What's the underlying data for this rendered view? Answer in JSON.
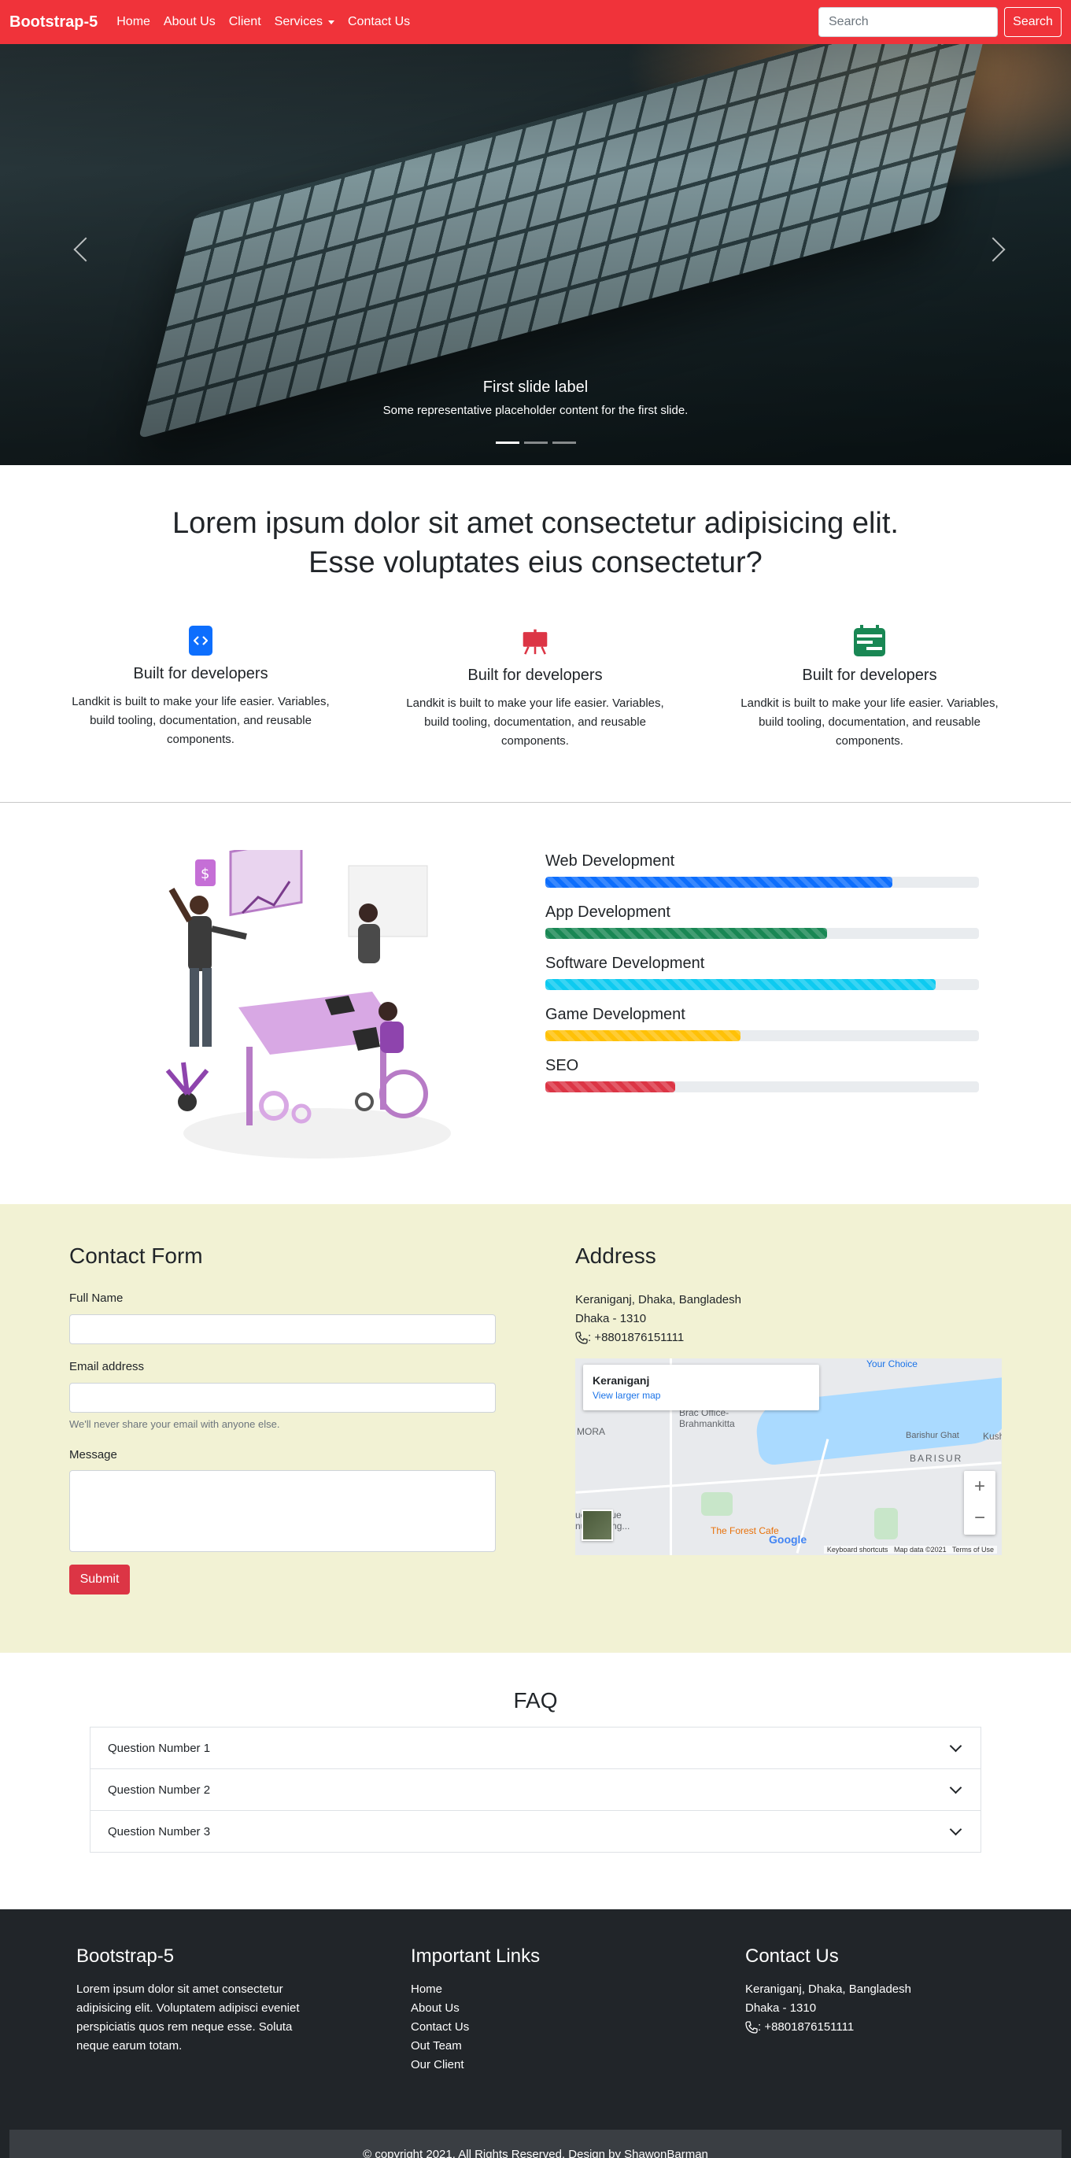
{
  "navbar": {
    "brand": "Bootstrap-5",
    "links": [
      "Home",
      "About Us",
      "Client",
      "Services",
      "Contact Us"
    ],
    "search_placeholder": "Search",
    "search_button": "Search",
    "color": "#f0333a"
  },
  "hero": {
    "caption_title": "First slide label",
    "caption_text": "Some representative placeholder content for the first slide.",
    "slides": 3,
    "active_slide": 1
  },
  "intro": {
    "heading_line1": "Lorem ipsum dolor sit amet consectetur adipisicing elit.",
    "heading_line2": "Esse voluptates eius consectetur?",
    "features": [
      {
        "icon": "code-icon",
        "color": "#0d6efd",
        "title": "Built for developers",
        "text": "Landkit is built to make your life easier. Variables, build tooling, documentation, and reusable components."
      },
      {
        "icon": "easel-icon",
        "color": "#dc3545",
        "title": "Built for developers",
        "text": "Landkit is built to make your life easier. Variables, build tooling, documentation, and reusable components."
      },
      {
        "icon": "calendar-icon",
        "color": "#198754",
        "title": "Built for developers",
        "text": "Landkit is built to make your life easier. Variables, build tooling, documentation, and reusable components."
      }
    ]
  },
  "skills": [
    {
      "label": "Web Development",
      "percent": 80,
      "color": "#0d6efd"
    },
    {
      "label": "App Development",
      "percent": 65,
      "color": "#198754"
    },
    {
      "label": "Software Development",
      "percent": 90,
      "color": "#0dcaf0"
    },
    {
      "label": "Game Development",
      "percent": 45,
      "color": "#ffc107"
    },
    {
      "label": "SEO",
      "percent": 30,
      "color": "#dc3545"
    }
  ],
  "contact": {
    "title": "Contact Form",
    "full_name_label": "Full Name",
    "email_label": "Email address",
    "email_help": "We'll never share your email with anyone else.",
    "message_label": "Message",
    "submit_label": "Submit",
    "address_title": "Address",
    "address_line1": "Keraniganj, Dhaka, Bangladesh",
    "address_line2": "Dhaka - 1310",
    "phone": ": +8801876151111",
    "map": {
      "place": "Keraniganj",
      "view_larger": "View larger map",
      "labels": [
        "Your Choice",
        "Brac Office-Brahmankitta",
        "MORA",
        "Barishur Ghat",
        "BARISUR",
        "Kush",
        "ue - Tissue",
        "nufacturing...",
        "The Forest Cafe",
        "Google"
      ],
      "footer": [
        "Keyboard shortcuts",
        "Map data ©2021",
        "Terms of Use"
      ],
      "zoom_in": "+",
      "zoom_out": "−"
    }
  },
  "faq": {
    "title": "FAQ",
    "questions": [
      "Question Number 1",
      "Question Number 2",
      "Question Number 3"
    ]
  },
  "footer": {
    "brand": "Bootstrap-5",
    "about": "Lorem ipsum dolor sit amet consectetur adipisicing elit. Voluptatem adipisci eveniet perspiciatis quos rem neque esse. Soluta neque earum totam.",
    "links_title": "Important Links",
    "links": [
      "Home",
      "About Us",
      "Contact Us",
      "Out Team",
      "Our Client"
    ],
    "contact_title": "Contact Us",
    "contact_line1": "Keraniganj, Dhaka, Bangladesh",
    "contact_line2": "Dhaka - 1310",
    "contact_phone": ": +8801876151111",
    "copyright": "© copyright 2021. All Rights Reserved. Design by ShawonBarman"
  }
}
